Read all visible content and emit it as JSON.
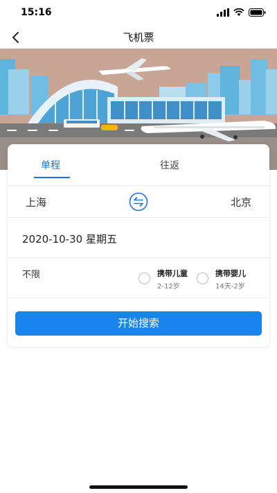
{
  "status_bar": {
    "time": "15:16"
  },
  "nav": {
    "title": "飞机票"
  },
  "tabs": {
    "one_way": "单程",
    "round_trip": "往返"
  },
  "route": {
    "from_city": "上海",
    "to_city": "北京"
  },
  "date": {
    "text": "2020-10-30 星期五"
  },
  "options": {
    "cabin": "不限",
    "child_label": "携带儿童",
    "child_age": "2-12岁",
    "infant_label": "携带婴儿",
    "infant_age": "14天-2岁"
  },
  "search_button": "开始搜索",
  "colors": {
    "accent": "#1a84ee",
    "tab_active": "#1a73e8"
  }
}
